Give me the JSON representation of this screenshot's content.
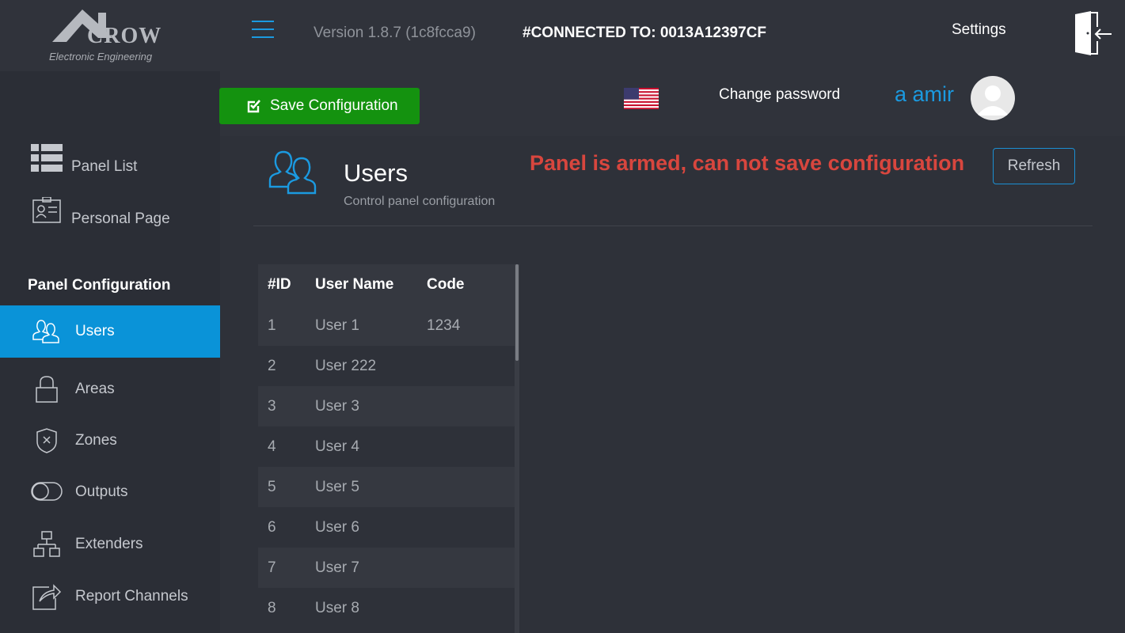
{
  "brand": {
    "name": "CROW",
    "tagline": "Electronic Engineering"
  },
  "topbar": {
    "version": "Version 1.8.7 (1c8fcca9)",
    "connected": "#CONNECTED TO: 0013A12397CF",
    "settings": "Settings",
    "save_label": "Save Configuration",
    "change_password": "Change password",
    "username": "a amir"
  },
  "sidebar": {
    "top_items": [
      {
        "label": "Panel List",
        "icon": "list-icon"
      },
      {
        "label": "Personal Page",
        "icon": "id-card-icon"
      }
    ],
    "section_title": "Panel Configuration",
    "items": [
      {
        "label": "Users",
        "icon": "users-icon",
        "active": true
      },
      {
        "label": "Areas",
        "icon": "lock-icon"
      },
      {
        "label": "Zones",
        "icon": "shield-icon"
      },
      {
        "label": "Outputs",
        "icon": "toggle-icon"
      },
      {
        "label": "Extenders",
        "icon": "network-icon"
      },
      {
        "label": "Report Channels",
        "icon": "share-icon"
      }
    ]
  },
  "main": {
    "title": "Users",
    "subtitle": "Control panel configuration",
    "warning": "Panel is armed, can not save configuration",
    "refresh_label": "Refresh",
    "table": {
      "headers": [
        "#ID",
        "User Name",
        "Code"
      ],
      "rows": [
        [
          "1",
          "User 1",
          "1234"
        ],
        [
          "2",
          "User 222",
          ""
        ],
        [
          "3",
          "User 3",
          ""
        ],
        [
          "4",
          "User 4",
          ""
        ],
        [
          "5",
          "User 5",
          ""
        ],
        [
          "6",
          "User 6",
          ""
        ],
        [
          "7",
          "User 7",
          ""
        ],
        [
          "8",
          "User 8",
          ""
        ]
      ]
    }
  },
  "colors": {
    "accent": "#0a93d8",
    "save_green": "#14920f",
    "warning_red": "#d8463e",
    "background": "#2b2e36"
  }
}
